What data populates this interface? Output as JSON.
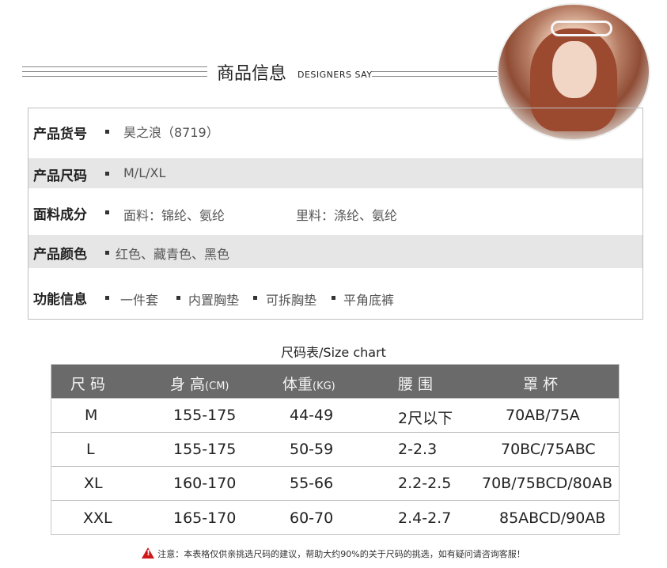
{
  "header": {
    "title": "商品信息",
    "subtitle": "DESIGNERS SAY"
  },
  "product_info": {
    "rows": [
      {
        "label": "产品货号",
        "values": [
          "昊之浪（8719）"
        ]
      },
      {
        "label": "产品尺码",
        "values": [
          "M/L/XL"
        ]
      },
      {
        "label": "面料成分",
        "values": [
          "面料：锦纶、氨纶",
          "里料：涤纶、氨纶"
        ]
      },
      {
        "label": "产品颜色",
        "values": [
          "红色、藏青色、黑色"
        ]
      },
      {
        "label": "功能信息",
        "values": [
          "一件套",
          "内置胸垫",
          "可拆胸垫",
          "平角底裤"
        ]
      }
    ]
  },
  "size_chart": {
    "title": "尺码表/Size chart",
    "headers": {
      "size": "尺 码",
      "height": "身 高",
      "height_unit": "(CM)",
      "weight": "体重",
      "weight_unit": "(KG)",
      "waist": "腰  围",
      "cup": "罩 杯"
    },
    "rows": [
      {
        "size": "M",
        "height": "155-175",
        "weight": "44-49",
        "waist": "2尺以下",
        "cup": "70AB/75A"
      },
      {
        "size": "L",
        "height": "155-175",
        "weight": "50-59",
        "waist": "2-2.3",
        "cup": "70BC/75ABC"
      },
      {
        "size": "XL",
        "height": "160-170",
        "weight": "55-66",
        "waist": "2.2-2.5",
        "cup": "70B/75BCD/80AB"
      },
      {
        "size": "XXL",
        "height": "165-170",
        "weight": "60-70",
        "waist": "2.4-2.7",
        "cup": "85ABCD/90AB"
      }
    ]
  },
  "note": "注意：本表格仅供亲挑选尺码的建议，帮助大约90%的关于尺码的挑选，如有疑问请咨询客服！",
  "colors": {
    "header_bar": "#6a6a6a",
    "shaded_row": "#e6e6e6",
    "warning": "#d01919"
  }
}
